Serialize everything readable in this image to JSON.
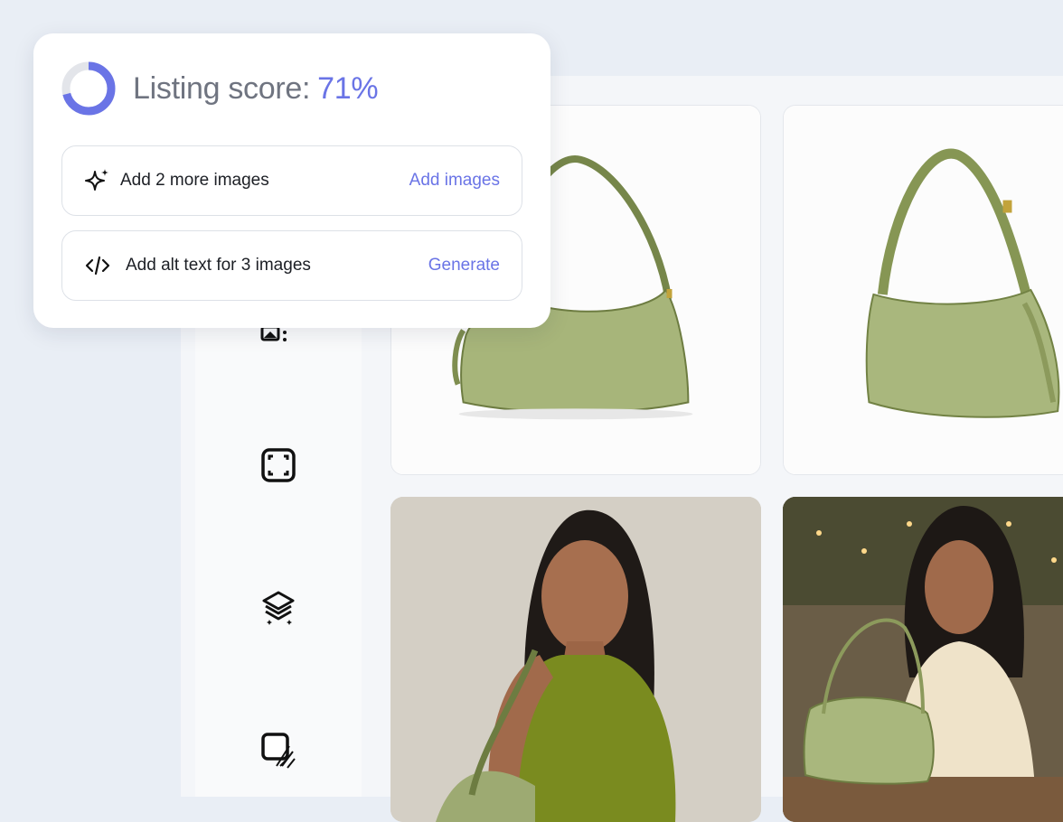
{
  "score_panel": {
    "label": "Listing score:",
    "value": "71%",
    "progress": 0.71,
    "accent_color": "#6a74e6",
    "tasks": [
      {
        "icon": "sparkle-icon",
        "label": "Add 2 more images",
        "action": "Add images"
      },
      {
        "icon": "code-icon",
        "label": "Add alt text for 3 images",
        "action": "Generate"
      }
    ]
  },
  "tool_rail": {
    "tools": [
      {
        "icon": "image-edit-icon"
      },
      {
        "icon": "crop-frame-icon"
      },
      {
        "icon": "layers-sparkle-icon"
      },
      {
        "icon": "shadow-square-icon"
      }
    ]
  },
  "gallery": {
    "items": [
      {
        "kind": "product photo",
        "subject": "green shoulder bag front"
      },
      {
        "kind": "product photo",
        "subject": "green shoulder bag angled"
      },
      {
        "kind": "lifestyle photo",
        "subject": "model with green bag"
      },
      {
        "kind": "lifestyle photo",
        "subject": "woman opening green bag at cafe"
      }
    ]
  }
}
